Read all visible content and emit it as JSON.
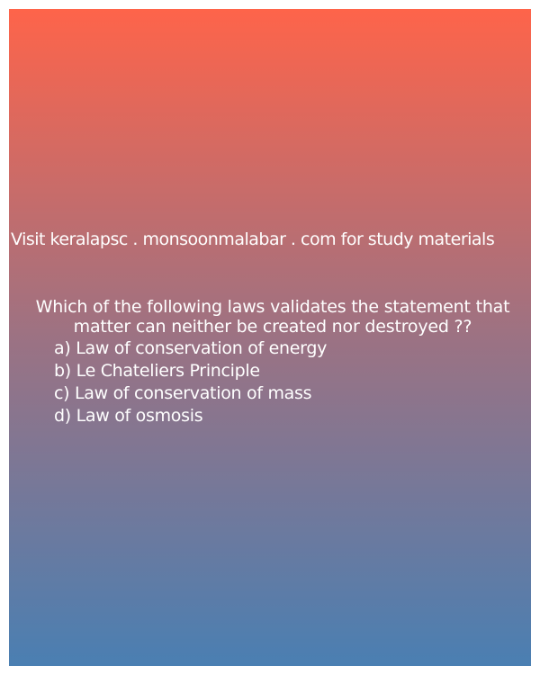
{
  "source_line": "Visit keralapsc . monsoonmalabar . com for study materials",
  "question": {
    "line1": "Which of the following laws validates the statement that",
    "line2": "matter can neither be created nor destroyed ??"
  },
  "options": [
    "a) Law of conservation of energy",
    "b) Le Chateliers Principle",
    "c) Law of conservation of mass",
    "d) Law of osmosis"
  ],
  "colors": {
    "gradient_top": "#fe644a",
    "gradient_bottom": "#4a7fb2",
    "text": "#ffffff"
  }
}
